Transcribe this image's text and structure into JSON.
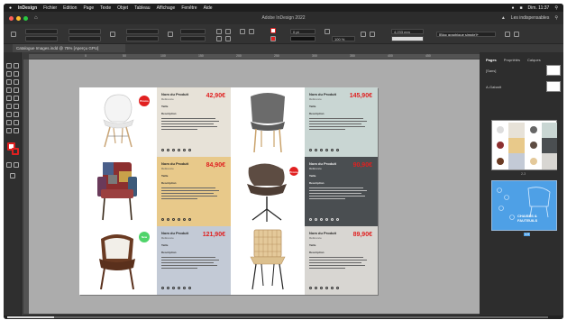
{
  "menubar": {
    "apple": "",
    "items": [
      "InDesign",
      "Fichier",
      "Edition",
      "Page",
      "Texte",
      "Objet",
      "Tableau",
      "Affichage",
      "Fenêtre",
      "Aide"
    ],
    "clock": "Dim. 11:37"
  },
  "window": {
    "title": "Adobe InDesign 2022",
    "workspace": "Les indispensables"
  },
  "control_bar": {
    "font_size": "0 pt",
    "width_value": "4,233 mm",
    "zoom": "100 %",
    "graphic_frame_style": "[Bloc graphique simple]+"
  },
  "document_tab": "Catalogue Images.indd @ 75% [Aperçu GPU]",
  "ruler": [
    "0",
    "50",
    "100",
    "150",
    "200",
    "250",
    "300",
    "350",
    "400",
    "450"
  ],
  "products": [
    {
      "name": "Nom du Produit",
      "ref": "Référence",
      "price": "42,90€",
      "size": "Taille",
      "desc": "Description",
      "bg": "#e7e2d8",
      "badge": "Promo",
      "badge_color": "#e12020"
    },
    {
      "name": "Nom du Produit",
      "ref": "Référence",
      "price": "145,90€",
      "size": "Taille",
      "desc": "Description",
      "bg": "#c9d6d3",
      "badge": "",
      "badge_color": ""
    },
    {
      "name": "Nom du Produit",
      "ref": "Référence",
      "price": "84,90€",
      "size": "Taille",
      "desc": "Description",
      "bg": "#e8c98a",
      "badge": "",
      "badge_color": ""
    },
    {
      "name": "Nom du Produit",
      "ref": "Référence",
      "price": "90,90€",
      "size": "Taille",
      "desc": "Description",
      "bg": "#4a4e51",
      "badge": "Promo",
      "badge_color": "#e12020"
    },
    {
      "name": "Nom du Produit",
      "ref": "Référence",
      "price": "121,90€",
      "size": "Taille",
      "desc": "Description",
      "bg": "#c3cad6",
      "badge": "New",
      "badge_color": "#4fd46a"
    },
    {
      "name": "Nom du Produit",
      "ref": "Référence",
      "price": "89,90€",
      "size": "Taille",
      "desc": "Description",
      "bg": "#d8d6d2",
      "badge": "",
      "badge_color": ""
    }
  ],
  "panels": {
    "tabs": [
      "Pages",
      "Propriétés",
      "Calques"
    ],
    "master_none": "[Sans]",
    "master_a": "A-Gabarit",
    "spread_label": "2-3",
    "spread_label2": "4-5",
    "cover_text": "CHAISES & FAUTEUILS"
  },
  "colors": {
    "accent_red": "#e02020",
    "pasteboard": "#acacac",
    "panel": "#2d2d2d",
    "selected_spread": "#4ea0e6"
  }
}
